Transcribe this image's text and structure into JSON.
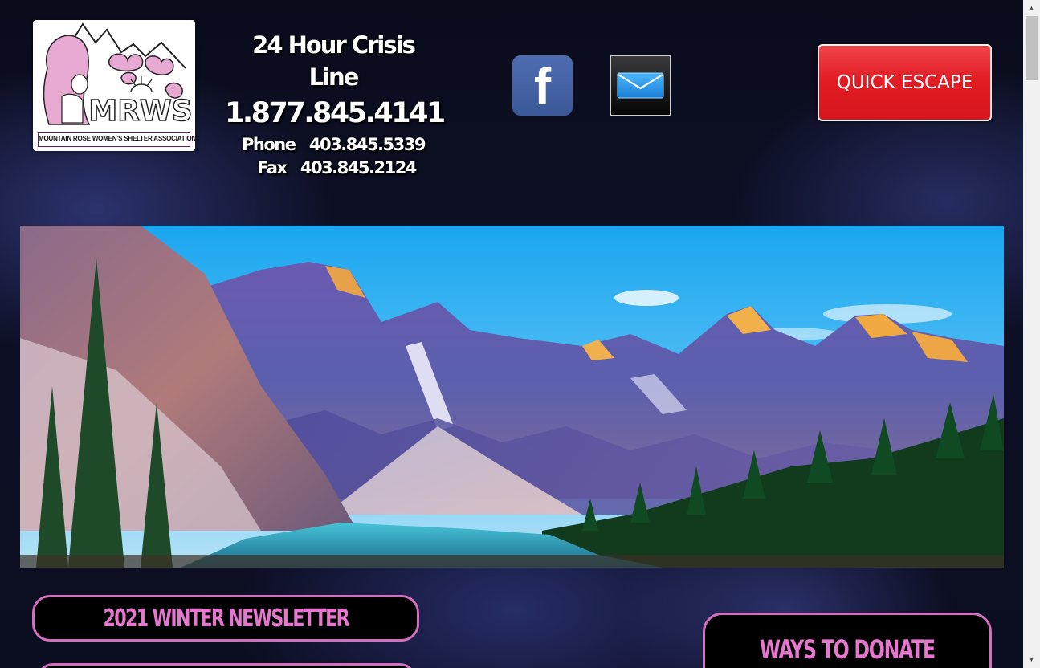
{
  "logo": {
    "initials": "MRWS",
    "org_name": "MOUNTAIN ROSE WOMEN'S SHELTER ASSOCIATION"
  },
  "crisis": {
    "title": "24 Hour Crisis Line",
    "number": "1.877.845.4141",
    "phone": "Phone   403.845.5339",
    "fax": "Fax   403.845.2124"
  },
  "social": {
    "facebook_icon": "facebook-icon",
    "facebook_letter": "f",
    "email_icon": "envelope-icon"
  },
  "escape_button": {
    "label": "QUICK ESCAPE"
  },
  "hero": {
    "image": "mountain-lake-landscape"
  },
  "links": {
    "newsletter": "2021 WINTER NEWSLETTER",
    "donate": "WAYS TO DONATE"
  },
  "colors": {
    "accent_pink": "#d36fbf",
    "escape_red": "#e21d24",
    "facebook_blue": "#3b5998",
    "background": "#0b0d20"
  }
}
